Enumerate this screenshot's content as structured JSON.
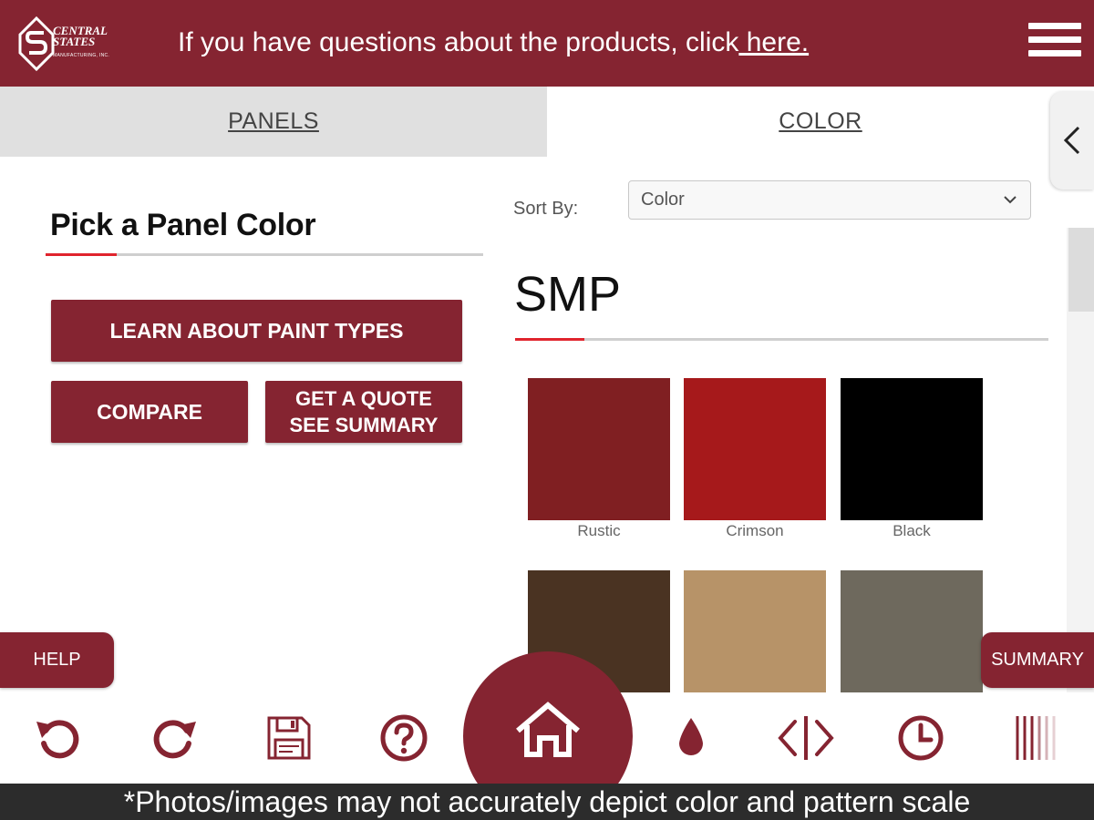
{
  "header": {
    "logo_line1": "CENTRAL",
    "logo_line2": "STATES",
    "logo_line3": "MANUFACTURING, INC.",
    "message": "If you have questions about the products, click",
    "link_text": " here."
  },
  "tabs": [
    {
      "label": "PANELS"
    },
    {
      "label": "COLOR"
    }
  ],
  "left": {
    "title": "Pick a Panel Color",
    "learn_button": "LEARN ABOUT PAINT TYPES",
    "compare_button": "COMPARE",
    "quote_line1": "GET A QUOTE",
    "quote_line2": "SEE SUMMARY"
  },
  "right": {
    "sort_label": "Sort By:",
    "sort_value": "Color",
    "section_title": "SMP"
  },
  "swatches": [
    {
      "name": "Rustic",
      "color": "#801f22"
    },
    {
      "name": "Crimson",
      "color": "#a6191b"
    },
    {
      "name": "Black",
      "color": "#000000"
    },
    {
      "name": "",
      "color": "#4a3322"
    },
    {
      "name": "",
      "color": "#b79368"
    },
    {
      "name": "",
      "color": "#6e695d"
    }
  ],
  "floating": {
    "help": "HELP",
    "summary": "SUMMARY"
  },
  "toolbar_icons": [
    "undo-icon",
    "redo-icon",
    "save-icon",
    "help-circle-icon",
    "home-icon",
    "color-drop-icon",
    "compare-icon",
    "history-icon",
    "panel-pattern-icon"
  ],
  "disclaimer": "*Photos/images may not accurately depict color and pattern scale",
  "colors": {
    "brand": "#852431",
    "accent": "#e0242d",
    "tab_inactive": "#e0e0e0"
  }
}
